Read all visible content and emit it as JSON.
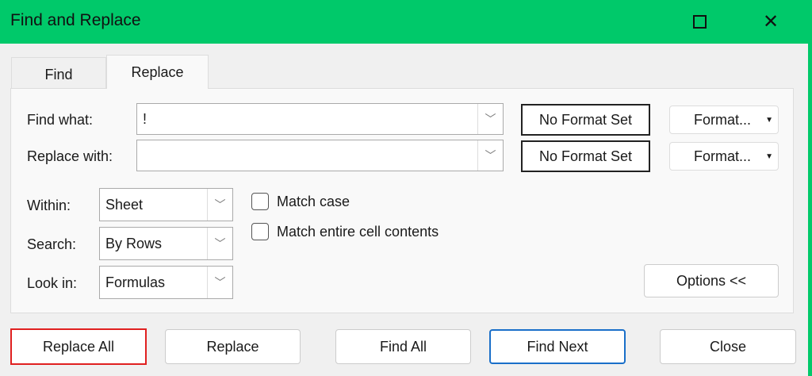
{
  "window": {
    "title": "Find and Replace",
    "minimize_icon": "minimize-icon",
    "maximize_icon": "maximize-icon",
    "close_icon": "close-icon"
  },
  "tabs": [
    {
      "label": "Find"
    },
    {
      "label": "Replace",
      "active": true
    }
  ],
  "find_what": {
    "label": "Find what:",
    "value": "!",
    "format": "No Format Set",
    "format_button": "Format..."
  },
  "replace_with": {
    "label": "Replace with:",
    "value": "",
    "format": "No Format Set",
    "format_button": "Format..."
  },
  "within": {
    "label": "Within:",
    "value": "Sheet"
  },
  "search": {
    "label": "Search:",
    "value": "By Rows"
  },
  "look_in": {
    "label": "Look in:",
    "value": "Formulas"
  },
  "match_case": {
    "label": "Match case",
    "checked": false
  },
  "match_entire": {
    "label": "Match entire cell contents",
    "checked": false
  },
  "options_button": "Options <<",
  "buttons": {
    "replace_all": "Replace All",
    "replace": "Replace",
    "find_all": "Find All",
    "find_next": "Find Next",
    "close": "Close"
  },
  "highlight_color": "#e02020"
}
